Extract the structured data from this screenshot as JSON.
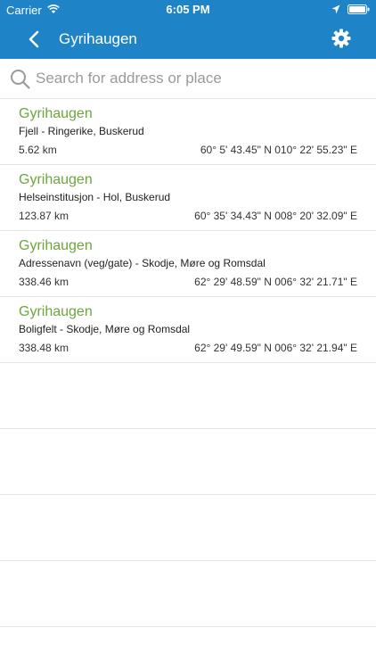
{
  "status": {
    "carrier": "Carrier",
    "time": "6:05 PM"
  },
  "nav": {
    "title": "Gyrihaugen"
  },
  "search": {
    "placeholder": "Search for address or place",
    "value": ""
  },
  "results": [
    {
      "name": "Gyrihaugen",
      "description": "Fjell - Ringerike, Buskerud",
      "distance": "5.62 km",
      "coordinates": "60° 5' 43.45\" N 010° 22' 55.23\" E"
    },
    {
      "name": "Gyrihaugen",
      "description": "Helseinstitusjon - Hol, Buskerud",
      "distance": "123.87 km",
      "coordinates": "60° 35' 34.43\" N 008° 20' 32.09\" E"
    },
    {
      "name": "Gyrihaugen",
      "description": "Adressenavn (veg/gate) - Skodje, Møre og Romsdal",
      "distance": "338.46 km",
      "coordinates": "62° 29' 48.59\" N 006° 32' 21.71\" E"
    },
    {
      "name": "Gyrihaugen",
      "description": "Boligfelt - Skodje, Møre og Romsdal",
      "distance": "338.48 km",
      "coordinates": "62° 29' 49.59\" N 006° 32' 21.94\" E"
    }
  ],
  "colors": {
    "bar": "#1f84c7",
    "name": "#6ca63c"
  },
  "icons": {
    "back": "chevron-left-icon",
    "settings": "gear-icon",
    "search": "search-icon"
  }
}
